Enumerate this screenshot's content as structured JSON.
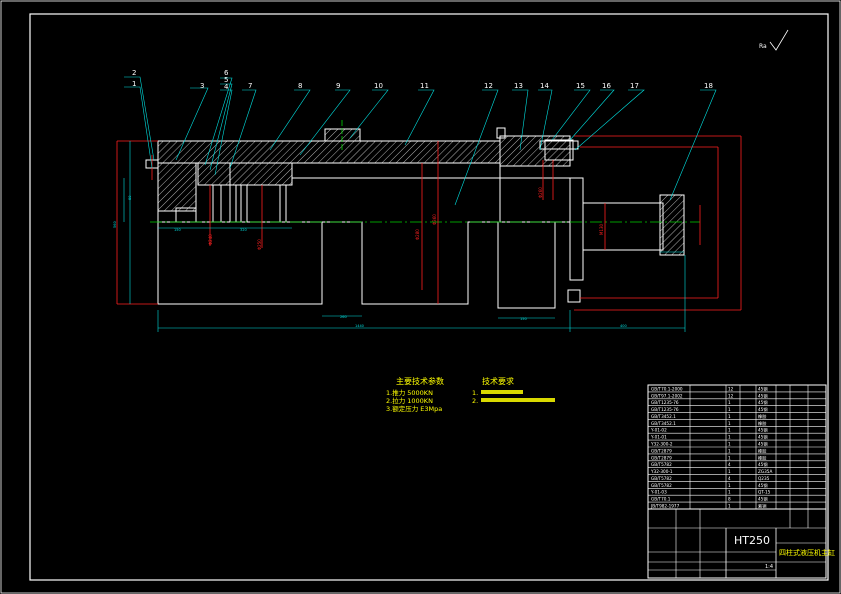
{
  "balloons": {
    "b1": "1",
    "b2": "2",
    "b3": "3",
    "b4": "4",
    "b5": "5",
    "b6": "6",
    "b7": "7",
    "b8": "8",
    "b9": "9",
    "b10": "10",
    "b11": "11",
    "b12": "12",
    "b13": "13",
    "b14": "14",
    "b15": "15",
    "b16": "16",
    "b17": "17",
    "b18": "18"
  },
  "notes": {
    "params_title": "主要技术参数",
    "param_1": "1.推力 5000KN",
    "param_2": "2.拉力 1000KN",
    "param_3": "3.额定压力 E3Mpa",
    "req_title": "技术要求"
  },
  "title_block": {
    "material": "HT250",
    "drawing_name": "四柱式液压机主缸",
    "scale": "1:4"
  },
  "bom": [
    {
      "code": "GB/T70.1-2000",
      "qty": "12",
      "mat": "45钢"
    },
    {
      "code": "GB/T97.1-2002",
      "qty": "12",
      "mat": "45钢"
    },
    {
      "code": "GB/T1235-76",
      "qty": "1",
      "mat": "45钢"
    },
    {
      "code": "GB/T1235-76",
      "qty": "1",
      "mat": "45钢"
    },
    {
      "code": "GB/T3452.1",
      "qty": "1",
      "mat": "橡胶"
    },
    {
      "code": "GB/T3452.1",
      "qty": "1",
      "mat": "橡胶"
    },
    {
      "code": "Y-01-02",
      "qty": "1",
      "mat": "45钢"
    },
    {
      "code": "Y-01-01",
      "qty": "1",
      "mat": "45钢"
    },
    {
      "code": "Y32-300-2",
      "qty": "1",
      "mat": "45钢"
    },
    {
      "code": "GB/T2879",
      "qty": "1",
      "mat": "橡胶"
    },
    {
      "code": "GB/T2879",
      "qty": "1",
      "mat": "橡胶"
    },
    {
      "code": "GB/T5782",
      "qty": "4",
      "mat": "45钢"
    },
    {
      "code": "Y32-300-1",
      "qty": "1",
      "mat": "ZG35A"
    },
    {
      "code": "GB/T5782",
      "qty": "4",
      "mat": "Q235"
    },
    {
      "code": "GB/T5782",
      "qty": "1",
      "mat": "45钢"
    },
    {
      "code": "Y-01-03",
      "qty": "1",
      "mat": "QT-15"
    },
    {
      "code": "GB/T70.1",
      "qty": "8",
      "mat": "45钢"
    },
    {
      "code": "JB/T982-1977",
      "qty": "1",
      "mat": "紫铜"
    }
  ]
}
